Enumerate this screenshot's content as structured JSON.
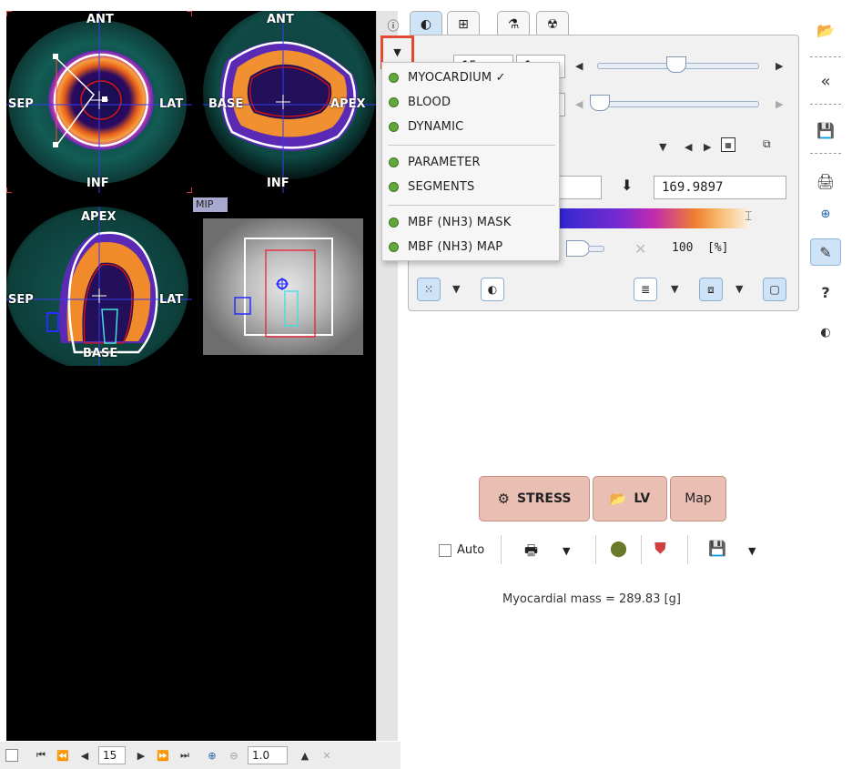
{
  "viewer": {
    "labels": {
      "short_axis": {
        "ant": "ANT",
        "inf": "INF",
        "sep": "SEP",
        "lat": "LAT"
      },
      "long_axis_horizontal": {
        "ant": "ANT",
        "inf": "INF",
        "base": "BASE",
        "apex": "APEX"
      },
      "long_axis_vertical": {
        "apex": "APEX",
        "base": "BASE",
        "sep": "SEP",
        "lat": "LAT"
      }
    },
    "mip_label": "MIP"
  },
  "bottombar": {
    "slice_value": "15",
    "zoom_value": "1.0"
  },
  "tabs": [
    {
      "icon": "contrast-icon",
      "active": true
    },
    {
      "icon": "grid-icon",
      "active": false
    },
    {
      "icon": "tools-icon",
      "active": false
    },
    {
      "icon": "radiation-icon",
      "active": false
    }
  ],
  "menu": {
    "trigger_icon": "chevron-down-icon",
    "items_group1": [
      {
        "label": "MYOCARDIUM ✓"
      },
      {
        "label": "BLOOD"
      },
      {
        "label": "DYNAMIC"
      }
    ],
    "items_group2": [
      {
        "label": "PARAMETER"
      },
      {
        "label": "SEGMENTS"
      }
    ],
    "items_group3": [
      {
        "label": "MBF (NH3) MASK"
      },
      {
        "label": "MBF (NH3) MAP"
      }
    ]
  },
  "controls": {
    "field1": "15",
    "field2": "1",
    "upper_value": "169.9897",
    "opacity_value": "100",
    "opacity_unit": "[%]",
    "slider1_level": 0.6,
    "slider2_level": 0.0
  },
  "actions": {
    "stress_label": "STRESS",
    "lv_label": "LV",
    "map_label": "Map",
    "auto_label": "Auto"
  },
  "status": {
    "mass_text": "Myocardial mass = 289.83 [g]"
  },
  "colors": {
    "accent_blue": "#cfe3f7",
    "menu_dot": "#63a63c",
    "action_button": "#e9bfb4",
    "highlight_red": "#e24a33"
  }
}
